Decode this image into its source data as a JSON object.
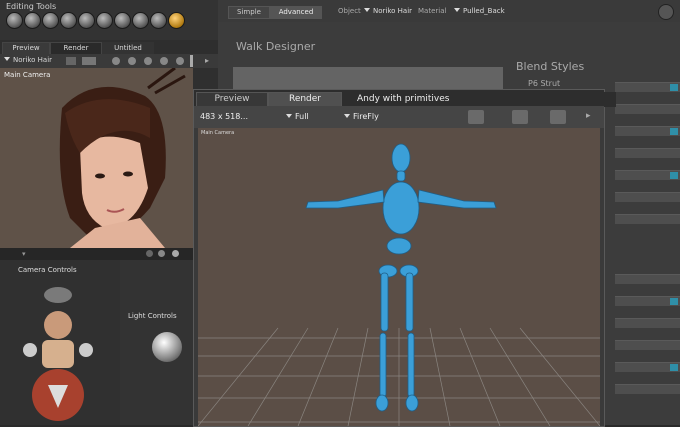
{
  "editing_tools": {
    "title": "Editing Tools"
  },
  "topbar": {
    "tab_simple": "Simple",
    "tab_advanced": "Advanced",
    "object_label": "Object",
    "object_value": "Noriko Hair",
    "material_label": "Material",
    "material_value": "Pulled_Back"
  },
  "left_panel": {
    "tabs": [
      "Preview",
      "Render",
      "Untitled"
    ],
    "figure_select": "Noriko Hair",
    "camera_label": "Main Camera",
    "camera_controls": "Camera Controls",
    "light_controls": "Light Controls"
  },
  "walk_designer": {
    "title": "Walk Designer",
    "blend_styles": "Blend Styles",
    "first_style": "P6 Strut"
  },
  "render_window": {
    "tabs": [
      "Preview",
      "Render"
    ],
    "doc_title": "Andy with primitives",
    "size_value": "483 x 518...",
    "quality_value": "Full",
    "renderer_value": "FireFly",
    "view_label": "Main Camera"
  },
  "colors": {
    "accent": "#2f8fa8",
    "figure": "#3b9fd8",
    "gold": "#d4a020"
  }
}
